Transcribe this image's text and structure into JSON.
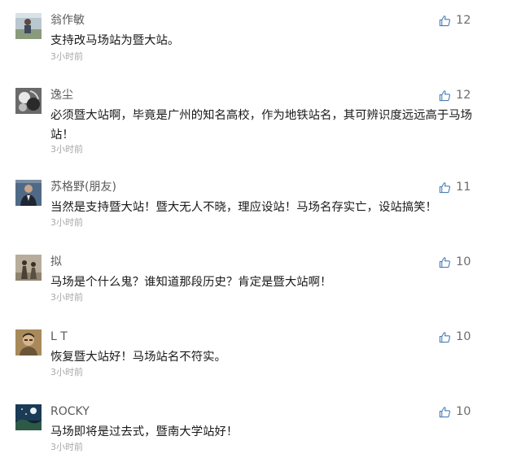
{
  "comments": [
    {
      "name": "翁作敏",
      "text": "支持改马场站为暨大站。",
      "time": "3小时前",
      "likes": "12",
      "avatar_icon": "user-photo-man-outdoor-icon"
    },
    {
      "name": "逸尘",
      "text": "必须暨大站啊，毕竟是广州的知名高校，作为地铁站名，其可辨识度远远高于马场站！",
      "time": "3小时前",
      "likes": "12",
      "avatar_icon": "user-photo-black-white-icon"
    },
    {
      "name": "苏格野(朋友)",
      "text": "当然是支持暨大站！暨大无人不晓，理应设站！马场名存实亡，设站搞笑！",
      "time": "3小时前",
      "likes": "11",
      "avatar_icon": "user-photo-man-suit-icon"
    },
    {
      "name": "拟",
      "text": "马场是个什么鬼？谁知道那段历史？肯定是暨大站啊！",
      "time": "3小时前",
      "likes": "10",
      "avatar_icon": "user-photo-figures-icon"
    },
    {
      "name": "L T",
      "text": "恢复暨大站好！马场站名不符实。",
      "time": "3小时前",
      "likes": "10",
      "avatar_icon": "user-photo-man-portrait-icon"
    },
    {
      "name": "ROCKY",
      "text": "马场即将是过去式，暨南大学站好！",
      "time": "3小时前",
      "likes": "10",
      "avatar_icon": "user-photo-night-sky-icon"
    }
  ],
  "colors": {
    "name": "#5a5a5a",
    "text": "#1a1a1a",
    "time": "#a8a8a8",
    "like_icon": "#4a7fb5",
    "like_count": "#6d6d6d"
  }
}
